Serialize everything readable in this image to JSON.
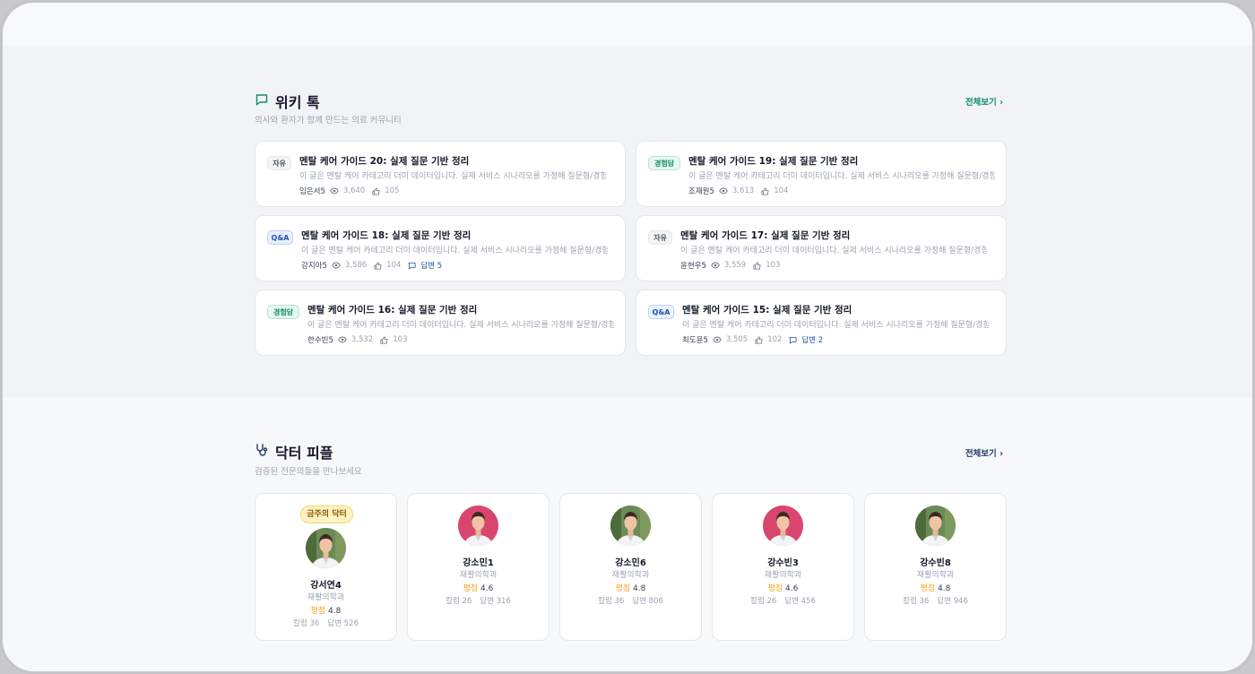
{
  "wiki": {
    "title": "위키 톡",
    "subtitle": "의사와 환자가 함께 만드는 의료 커뮤니티",
    "view_all": "전체보기 ›",
    "accent": "#0f8f6b",
    "posts": [
      {
        "badge": "자유",
        "badge_type": "free",
        "title": "멘탈 케어 가이드 20: 실제 질문 기반 정리",
        "desc": "이 글은 멘탈 케어 카테고리 더미 데이터입니다. 실제 서비스 시나리오를 가정해 질문형/경험형 ...",
        "author": "임은서5",
        "views": "3,640",
        "likes": "105",
        "answers": ""
      },
      {
        "badge": "경험담",
        "badge_type": "exp",
        "title": "멘탈 케어 가이드 19: 실제 질문 기반 정리",
        "desc": "이 글은 멘탈 케어 카테고리 더미 데이터입니다. 실제 서비스 시나리오를 가정해 질문형/경험형 ...",
        "author": "조재원5",
        "views": "3,613",
        "likes": "104",
        "answers": ""
      },
      {
        "badge": "Q&A",
        "badge_type": "qa",
        "title": "멘탈 케어 가이드 18: 실제 질문 기반 정리",
        "desc": "이 글은 멘탈 케어 카테고리 더미 데이터입니다. 실제 서비스 시나리오를 가정해 질문형/경험형 ...",
        "author": "강지아5",
        "views": "3,586",
        "likes": "104",
        "answers": "답변 5"
      },
      {
        "badge": "자유",
        "badge_type": "free",
        "title": "멘탈 케어 가이드 17: 실제 질문 기반 정리",
        "desc": "이 글은 멘탈 케어 카테고리 더미 데이터입니다. 실제 서비스 시나리오를 가정해 질문형/경험형 ...",
        "author": "윤현우5",
        "views": "3,559",
        "likes": "103",
        "answers": ""
      },
      {
        "badge": "경험담",
        "badge_type": "exp",
        "title": "멘탈 케어 가이드 16: 실제 질문 기반 정리",
        "desc": "이 글은 멘탈 케어 카테고리 더미 데이터입니다. 실제 서비스 시나리오를 가정해 질문형/경험형 ...",
        "author": "한수빈5",
        "views": "3,532",
        "likes": "103",
        "answers": ""
      },
      {
        "badge": "Q&A",
        "badge_type": "qa",
        "title": "멘탈 케어 가이드 15: 실제 질문 기반 정리",
        "desc": "이 글은 멘탈 케어 카테고리 더미 데이터입니다. 실제 서비스 시나리오를 가정해 질문형/경험형 ...",
        "author": "최도윤5",
        "views": "3,505",
        "likes": "102",
        "answers": "답변 2"
      }
    ]
  },
  "doctors": {
    "title": "닥터 피플",
    "subtitle": "검증된 전문의들을 만나보세요",
    "view_all": "전체보기 ›",
    "accent": "#1e3a5f",
    "weekly_badge": "금주의 닥터",
    "rating_label": "평점",
    "items": [
      {
        "name": "강서연4",
        "dept": "재활의학과",
        "rating": "4.8",
        "columns": "칼럼 36",
        "answers": "답변 526",
        "photo_bg": "green",
        "featured": true
      },
      {
        "name": "강소민1",
        "dept": "재활의학과",
        "rating": "4.6",
        "columns": "칼럼 26",
        "answers": "답변 316",
        "photo_bg": "pink",
        "featured": false
      },
      {
        "name": "강소민6",
        "dept": "재활의학과",
        "rating": "4.8",
        "columns": "칼럼 36",
        "answers": "답변 806",
        "photo_bg": "green",
        "featured": false
      },
      {
        "name": "강수빈3",
        "dept": "재활의학과",
        "rating": "4.6",
        "columns": "칼럼 26",
        "answers": "답변 456",
        "photo_bg": "pink",
        "featured": false
      },
      {
        "name": "강수빈8",
        "dept": "재활의학과",
        "rating": "4.8",
        "columns": "칼럼 36",
        "answers": "답변 946",
        "photo_bg": "green",
        "featured": false
      }
    ]
  }
}
